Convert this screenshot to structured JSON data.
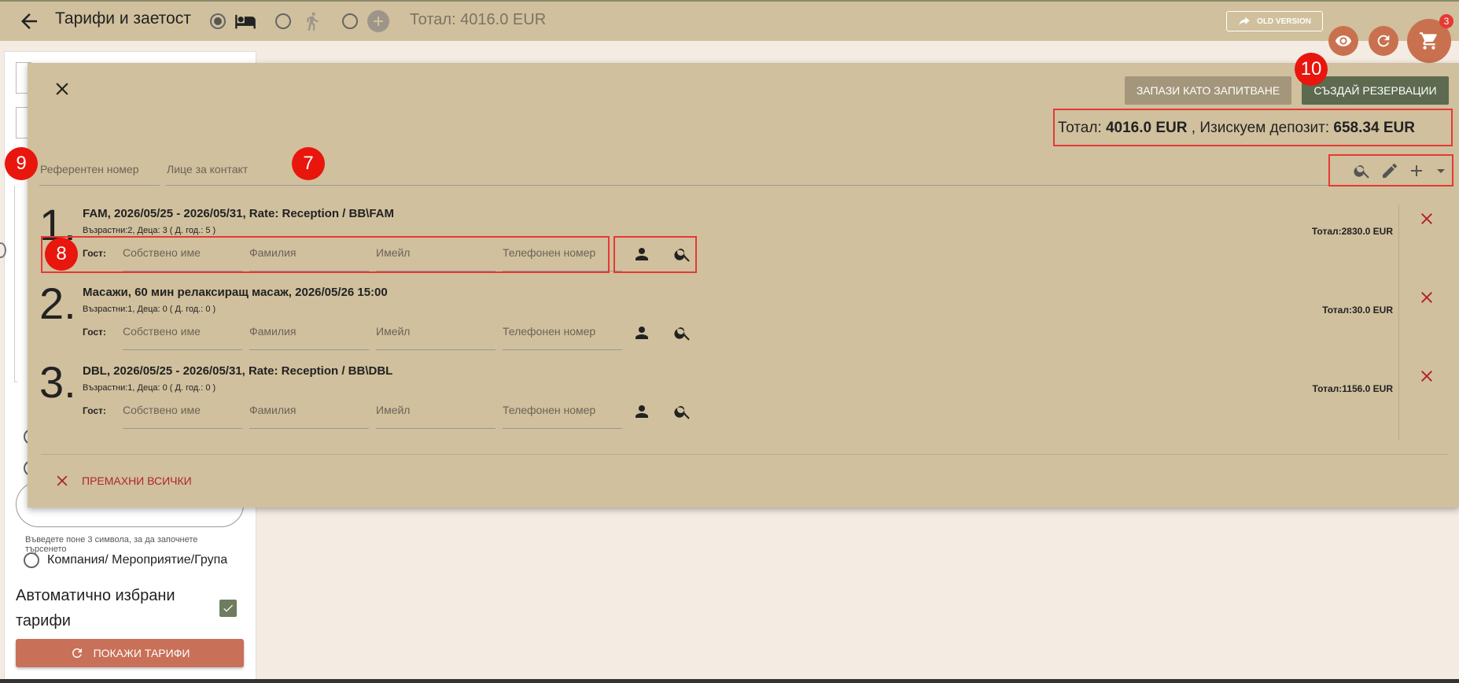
{
  "topbar": {
    "title": "Тарифи и заетост",
    "total": "Тотал: 4016.0 EUR",
    "old_version": "OLD VERSION",
    "cart_count": "3",
    "icons": [
      "back-arrow-icon",
      "bed-icon",
      "running-person-icon",
      "add-circle-icon",
      "share-icon",
      "eye-icon",
      "refresh-icon",
      "cart-icon"
    ]
  },
  "left": {
    "search_hint": "Въведете поне 3 символа, за да започнете търсенето",
    "company_label": "Компания/ Мероприятие/Група",
    "auto_rates_label": "Автоматично избрани тарифи",
    "show_rates_button": "ПОКАЖИ ТАРИФИ"
  },
  "dialog": {
    "save_inquiry": "ЗАПАЗИ КАТО ЗАПИТВАНЕ",
    "create_reservations": "СЪЗДАЙ РЕЗЕРВАЦИИ",
    "summary": {
      "total_label": "Тотал: ",
      "total_value": "4016.0 EUR",
      "deposit_label": " , Изискуем депозит: ",
      "deposit_value": "658.34 EUR"
    },
    "ref_placeholder": "Референтен номер",
    "contact_placeholder": "Лице за контакт",
    "remove_all": "ПРЕМАХНИ ВСИЧКИ",
    "guest_label": "Гост:",
    "guest_fields": {
      "first_name": "Собствено име",
      "last_name": "Фамилия",
      "email": "Имейл",
      "phone": "Телефонен номер"
    },
    "items": [
      {
        "number": "1.",
        "title": "FAM, 2026/05/25 - 2026/05/31, Rate: Reception / BB\\FAM",
        "sub": "Възрастни:2, Деца: 3 ( Д. год.: 5 )",
        "total": "Тотал:2830.0 EUR"
      },
      {
        "number": "2.",
        "title": "Масажи, 60 мин релаксиращ масаж, 2026/05/26 15:00",
        "sub": "Възрастни:1, Деца: 0 ( Д. год.: 0 )",
        "total": "Тотал:30.0 EUR"
      },
      {
        "number": "3.",
        "title": "DBL, 2026/05/25 - 2026/05/31, Rate: Reception / BB\\DBL",
        "sub": "Възрастни:1, Деца: 0 ( Д. год.: 0 )",
        "total": "Тотал:1156.0 EUR"
      }
    ]
  },
  "callouts": [
    "9",
    "7",
    "8",
    "10"
  ]
}
